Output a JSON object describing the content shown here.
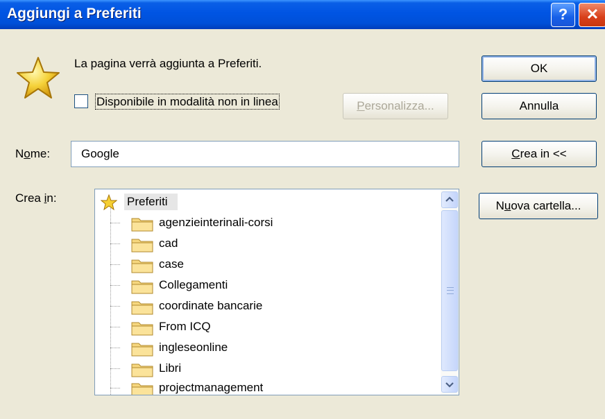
{
  "window": {
    "title": "Aggiungi a Preferiti",
    "help_glyph": "?",
    "close_glyph": "✕"
  },
  "message": "La pagina verrà aggiunta a Preferiti.",
  "offline_checkbox": {
    "label": "Disponibile in modalità non in linea",
    "checked": false
  },
  "buttons": {
    "ok": "OK",
    "annulla": "Annulla",
    "personalizza": {
      "prefix": "P",
      "rest": "ersonalizza..."
    },
    "crea_in": {
      "prefix": "C",
      "rest": "rea in <<"
    },
    "nuova_cartella": {
      "pre": "N",
      "mnemonic": "u",
      "rest": "ova cartella..."
    }
  },
  "name_field": {
    "label": {
      "pre": "N",
      "mnemonic": "o",
      "rest": "me:"
    },
    "value": "Google"
  },
  "create_in": {
    "label": {
      "pre": "Crea ",
      "mnemonic": "i",
      "rest": "n:"
    },
    "root": "Preferiti",
    "folders": [
      "agenzieinterinali-corsi",
      "cad",
      "case",
      "Collegamenti",
      "coordinate bancarie",
      "From ICQ",
      "ingleseonline",
      "Libri",
      "projectmanagement"
    ]
  },
  "icons": {
    "dialog": "favorites-star-icon",
    "folder": "folder-icon",
    "scroll_up": "chevron-up-icon",
    "scroll_down": "chevron-down-icon"
  },
  "colors": {
    "titlebar": "#0054e3",
    "dialog_bg": "#ece9d8",
    "close_button": "#d83f1a"
  }
}
